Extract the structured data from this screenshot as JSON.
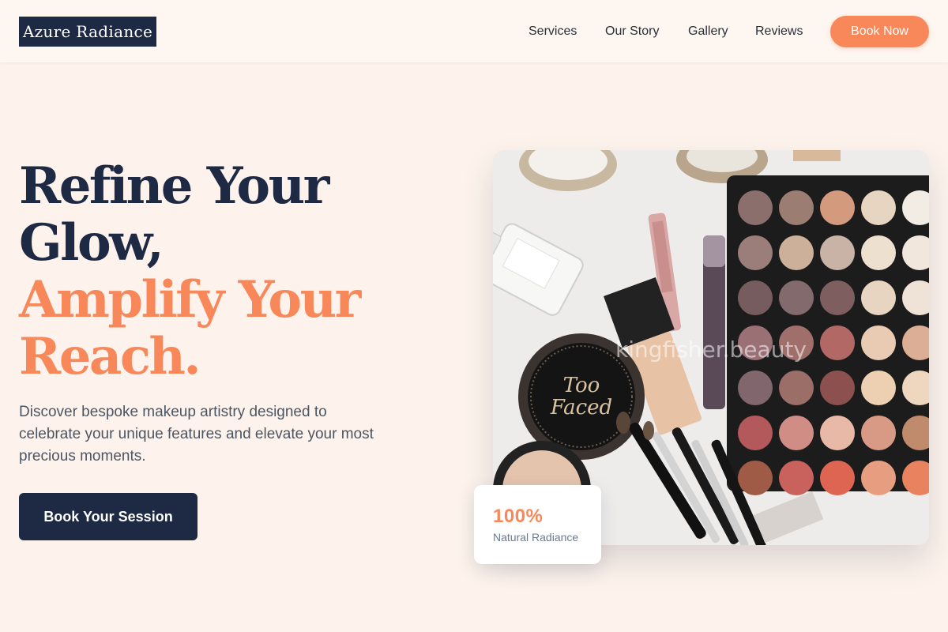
{
  "brand": {
    "name": "Azure Radiance"
  },
  "nav": {
    "items": [
      {
        "label": "Services"
      },
      {
        "label": "Our Story"
      },
      {
        "label": "Gallery"
      },
      {
        "label": "Reviews"
      }
    ],
    "cta_label": "Book Now"
  },
  "hero": {
    "title_lines": [
      "Refine Your",
      "Glow,",
      "Amplify Your",
      "Reach."
    ],
    "description": "Discover bespoke makeup artistry designed to celebrate your unique features and elevate your most precious moments.",
    "cta_label": "Book Your Session"
  },
  "image": {
    "watermark": "kingfisher.beauty"
  },
  "stat": {
    "value": "100%",
    "label": "Natural Radiance"
  },
  "colors": {
    "navy": "#1e2a44",
    "accent": "#f8875a",
    "background": "#fdf3ec"
  },
  "icons": {
    "hero_image": "makeup-products-photo"
  }
}
